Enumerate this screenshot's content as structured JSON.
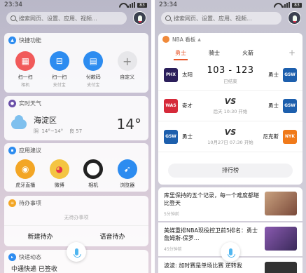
{
  "left": {
    "status": {
      "time": "23:34",
      "battery": "83"
    },
    "search": {
      "placeholder": "搜索网页、设置、应用、视频..."
    },
    "quick": {
      "title": "快捷功能",
      "items": [
        {
          "label": "扫一扫",
          "sub": "相机",
          "icon": "scan-icon",
          "color": "#f15a5a"
        },
        {
          "label": "扫一扫",
          "sub": "支付宝",
          "icon": "alipay-scan-icon",
          "color": "#2d8cf0"
        },
        {
          "label": "付款码",
          "sub": "支付宝",
          "icon": "pay-code-icon",
          "color": "#2d8cf0"
        },
        {
          "label": "自定义",
          "sub": "",
          "icon": "plus-icon",
          "color": "#e7e7ea"
        }
      ]
    },
    "weather": {
      "title": "实时天气",
      "city": "海淀区",
      "detail": "阴  14°~14°    良 57",
      "temp": "14°"
    },
    "apps": {
      "title": "应用建议",
      "items": [
        {
          "label": "虎牙直播",
          "icon": "huya-icon",
          "color": "#f3a625"
        },
        {
          "label": "微博",
          "icon": "weibo-icon",
          "color": "#f4c542"
        },
        {
          "label": "相机",
          "icon": "camera-icon",
          "color": "#222222"
        },
        {
          "label": "浏览器",
          "icon": "browser-icon",
          "color": "#2d8cf0"
        }
      ]
    },
    "todo": {
      "title": "待办事项",
      "empty": "无待办事项",
      "new_btn": "新建待办",
      "voice_btn": "语音待办"
    },
    "dynamic": {
      "title": "快递动态",
      "text": "中通快递 已签收"
    }
  },
  "right": {
    "status": {
      "time": "23:34",
      "battery": "83"
    },
    "search": {
      "placeholder": "搜索网页、设置、应用、视频..."
    },
    "nba": {
      "title": "NBA 看板",
      "tabs": [
        "勇士",
        "骑士",
        "火箭"
      ],
      "games": [
        {
          "home": "太阳",
          "home_abbr": "PHX",
          "home_color": "#2b1f5b",
          "away": "勇士",
          "away_abbr": "GSW",
          "away_color": "#1d5fad",
          "center": "103 - 123",
          "status": "已结束"
        },
        {
          "home": "奇才",
          "home_abbr": "WAS",
          "home_color": "#d62a3a",
          "away": "勇士",
          "away_abbr": "GSW",
          "away_color": "#1d5fad",
          "center": "VS",
          "status": "后天 10:30 开始"
        },
        {
          "home": "勇士",
          "home_abbr": "GSW",
          "home_color": "#1d5fad",
          "away": "尼克斯",
          "away_abbr": "NYK",
          "away_color": "#f07a1a",
          "center": "VS",
          "status": "10月27日 07:30 开始"
        }
      ],
      "rank_btn": "排行榜"
    },
    "news": [
      {
        "title": "库里保持的五个记录，每一个难度都堪比登天",
        "meta": "5分钟前",
        "img_color": "#b58a6a"
      },
      {
        "title": "美媒重排NBA现役控卫前5排名：勇士詹姆斯-保罗...",
        "meta": "45分钟前",
        "img_color": "#6a4a8a"
      },
      {
        "title": "波波: 加时赛是单场比赛 逆转我",
        "meta": "",
        "img_color": "#333"
      }
    ]
  }
}
